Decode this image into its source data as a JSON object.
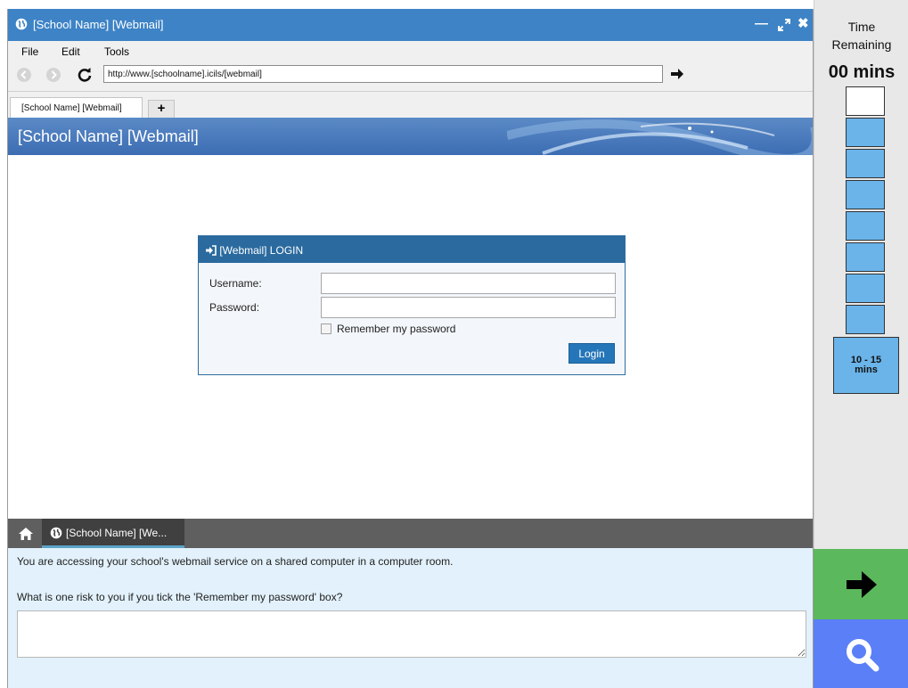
{
  "window": {
    "title": "[School Name] [Webmail]"
  },
  "menu": [
    "File",
    "Edit",
    "Tools"
  ],
  "address": {
    "url": "http://www.[schoolname].icils/[webmail]"
  },
  "browser_tab": {
    "label": "[School Name] [Webmail]",
    "new_tab": "+"
  },
  "banner": {
    "title": "[School Name] [Webmail]"
  },
  "login": {
    "header": "[Webmail] LOGIN",
    "username_label": "Username:",
    "password_label": "Password:",
    "remember_label": "Remember my password",
    "remember_checked": false,
    "button": "Login"
  },
  "task_tab": {
    "label": "[School Name] [We..."
  },
  "question": {
    "line1": "You are accessing your school's webmail service on a shared computer in a computer room.",
    "line2": "What is one risk to you if you tick the 'Remember my password' box?",
    "answer_value": ""
  },
  "timer": {
    "label_line1": "Time",
    "label_line2": "Remaining",
    "minutes": "00 mins",
    "range_line1": "10 - 15",
    "range_line2": "mins",
    "empty_blocks": 1,
    "filled_blocks": 7
  },
  "colors": {
    "titlebar": "#3d83c6",
    "login_header": "#2a6a9e",
    "timer_fill": "#6ab4ea",
    "next": "#5cb85c",
    "search": "#5b7ff7",
    "question_bg": "#e2f1fb"
  },
  "icons": {
    "title": "globe-icon",
    "back": "back-arrow-icon",
    "forward": "forward-arrow-icon",
    "reload": "refresh-icon",
    "go": "arrow-right-icon",
    "login": "sign-in-icon",
    "home": "home-icon",
    "next": "arrow-right-icon",
    "search": "magnifier-icon"
  }
}
